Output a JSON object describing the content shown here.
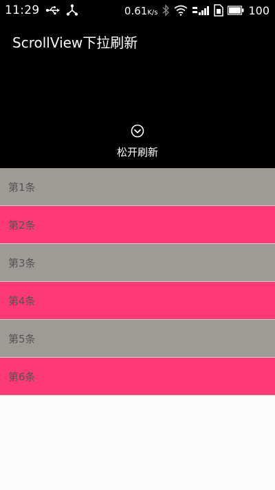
{
  "status_bar": {
    "time": "11:29",
    "net_speed": "0.61",
    "net_unit": "K/s",
    "battery": "100",
    "icons": [
      "usb-icon",
      "share-icon",
      "bluetooth-icon",
      "wifi-icon",
      "signal-icon",
      "sim-icon",
      "battery-icon"
    ]
  },
  "app": {
    "title": "ScrollView下拉刷新"
  },
  "refresh": {
    "label": "松开刷新",
    "icon": "chevron-down-circle-icon"
  },
  "list": {
    "items": [
      {
        "label": "第1条",
        "color": "#9e9b96"
      },
      {
        "label": "第2条",
        "color": "#fd3a77"
      },
      {
        "label": "第3条",
        "color": "#9e9b96"
      },
      {
        "label": "第4条",
        "color": "#fd3a77"
      },
      {
        "label": "第5条",
        "color": "#9e9b96"
      },
      {
        "label": "第6条",
        "color": "#fd3a77"
      }
    ]
  },
  "colors": {
    "header_bg": "#000000",
    "list_gray": "#9e9b96",
    "list_pink": "#fd3a77",
    "page_bg": "#fbfbfb"
  }
}
